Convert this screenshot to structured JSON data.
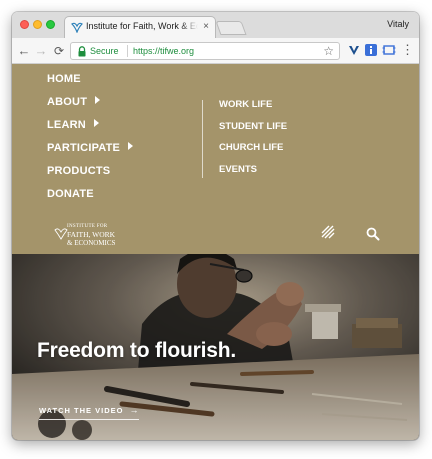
{
  "browser": {
    "tab_title": "Institute for Faith, Work & Economics",
    "tab_close": "×",
    "profile_name": "Vitaly",
    "security_label": "Secure",
    "url": "https://tifwe.org",
    "star": "☆",
    "menu": "⋮",
    "back": "←",
    "forward": "→",
    "reload": "⟳"
  },
  "site": {
    "main_nav": [
      {
        "label": "HOME",
        "has_submenu": false
      },
      {
        "label": "ABOUT",
        "has_submenu": true
      },
      {
        "label": "LEARN",
        "has_submenu": true
      },
      {
        "label": "PARTICIPATE",
        "has_submenu": true
      },
      {
        "label": "PRODUCTS",
        "has_submenu": false
      },
      {
        "label": "DONATE",
        "has_submenu": false
      }
    ],
    "sub_nav": [
      "WORK LIFE",
      "STUDENT LIFE",
      "CHURCH LIFE",
      "EVENTS"
    ],
    "logo": {
      "line1": "INSTITUTE FOR",
      "line2": "FAITH, WORK",
      "line3": "& ECONOMICS"
    },
    "icons": [
      "hamburger-icon",
      "search-icon"
    ],
    "hero": {
      "headline": "Freedom to flourish.",
      "cta": "WATCH THE VIDEO",
      "cta_arrow": "→"
    }
  },
  "colors": {
    "nav_background": "#a4946a",
    "text": "#ffffff",
    "secure_green": "#1e8e3e"
  }
}
